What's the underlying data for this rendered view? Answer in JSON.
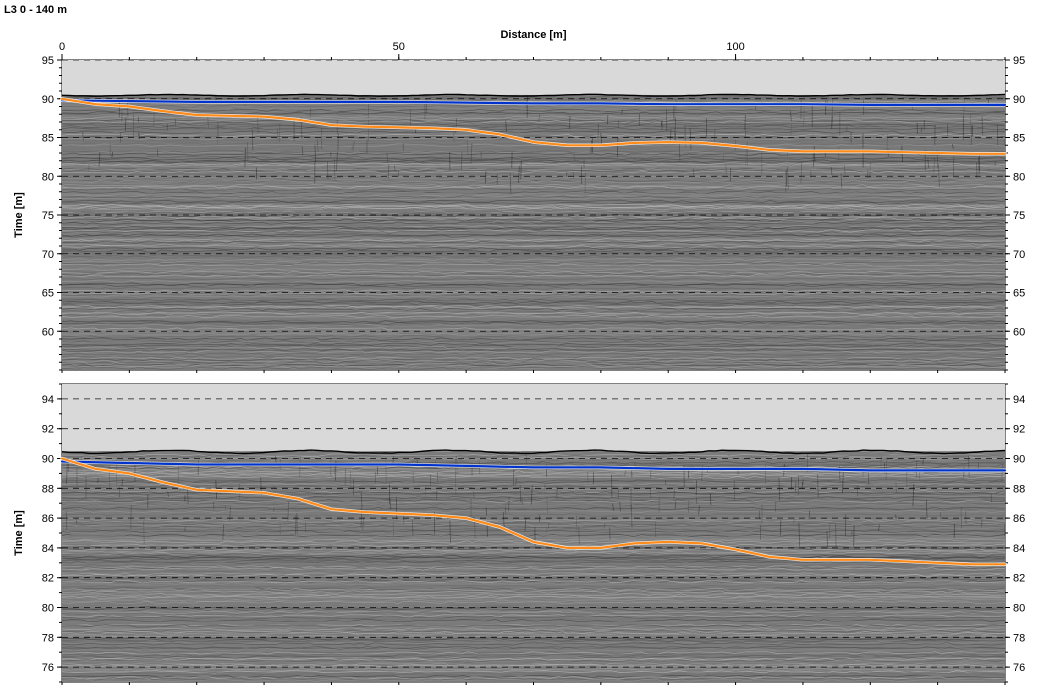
{
  "title": "L3 0 - 140 m",
  "xaxis": {
    "label": "Distance [m]",
    "min": 0,
    "max": 140,
    "ticks": [
      0,
      50,
      100
    ]
  },
  "chart_data": [
    {
      "type": "line",
      "title": "Upper profile (full depth view)",
      "xlabel": "Distance [m]",
      "ylabel": "Time [m]",
      "x_range": [
        0,
        140
      ],
      "y_range": [
        55,
        95
      ],
      "y_ticks": [
        60,
        65,
        70,
        75,
        80,
        85,
        90,
        95
      ],
      "surface_top": 90.5,
      "surface_bottom": 56,
      "series": [
        {
          "name": "Blue horizon",
          "color": "#0033cc",
          "x": [
            0,
            10,
            20,
            30,
            40,
            50,
            60,
            70,
            80,
            90,
            100,
            110,
            120,
            130,
            140
          ],
          "values": [
            89.8,
            89.7,
            89.6,
            89.6,
            89.6,
            89.6,
            89.5,
            89.4,
            89.4,
            89.3,
            89.3,
            89.3,
            89.2,
            89.2,
            89.2
          ]
        },
        {
          "name": "Orange horizon",
          "color": "#ff8c1a",
          "x": [
            0,
            5,
            10,
            15,
            20,
            25,
            30,
            35,
            40,
            45,
            50,
            55,
            60,
            65,
            70,
            75,
            80,
            85,
            90,
            95,
            100,
            105,
            110,
            115,
            120,
            125,
            130,
            135,
            140
          ],
          "values": [
            90.0,
            89.3,
            89.0,
            88.4,
            87.9,
            87.8,
            87.7,
            87.3,
            86.6,
            86.4,
            86.3,
            86.2,
            86.0,
            85.4,
            84.4,
            84.0,
            84.0,
            84.3,
            84.4,
            84.3,
            83.9,
            83.4,
            83.2,
            83.2,
            83.2,
            83.1,
            83.0,
            82.9,
            82.9
          ]
        }
      ]
    },
    {
      "type": "line",
      "title": "Lower profile (zoomed depth view)",
      "xlabel": "Distance [m]",
      "ylabel": "Time [m]",
      "x_range": [
        0,
        140
      ],
      "y_range": [
        75,
        95
      ],
      "y_ticks": [
        76,
        78,
        80,
        82,
        84,
        86,
        88,
        90,
        92,
        94
      ],
      "surface_top": 90.5,
      "surface_bottom": 75,
      "series": [
        {
          "name": "Blue horizon",
          "color": "#0033cc",
          "x": [
            0,
            10,
            20,
            30,
            40,
            50,
            60,
            70,
            80,
            90,
            100,
            110,
            120,
            130,
            140
          ],
          "values": [
            89.8,
            89.7,
            89.6,
            89.6,
            89.6,
            89.6,
            89.5,
            89.4,
            89.4,
            89.3,
            89.3,
            89.3,
            89.2,
            89.2,
            89.2
          ]
        },
        {
          "name": "Orange horizon",
          "color": "#ff8c1a",
          "x": [
            0,
            5,
            10,
            15,
            20,
            25,
            30,
            35,
            40,
            45,
            50,
            55,
            60,
            65,
            70,
            75,
            80,
            85,
            90,
            95,
            100,
            105,
            110,
            115,
            120,
            125,
            130,
            135,
            140
          ],
          "values": [
            90.0,
            89.3,
            89.0,
            88.4,
            87.9,
            87.8,
            87.7,
            87.3,
            86.6,
            86.4,
            86.3,
            86.2,
            86.0,
            85.4,
            84.4,
            84.0,
            84.0,
            84.3,
            84.4,
            84.3,
            83.9,
            83.4,
            83.2,
            83.2,
            83.2,
            83.1,
            83.0,
            82.9,
            82.9
          ]
        }
      ]
    }
  ]
}
